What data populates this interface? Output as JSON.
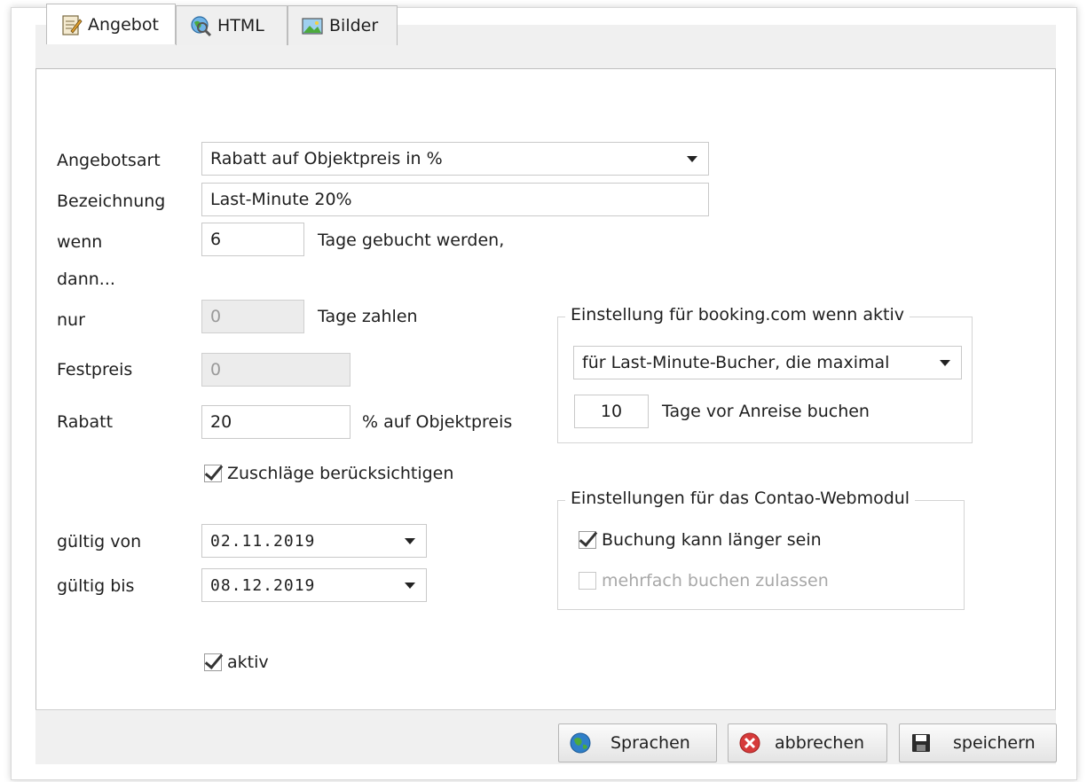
{
  "tabs": [
    {
      "label": "Angebot",
      "icon": "notepad-icon",
      "active": true
    },
    {
      "label": "HTML",
      "icon": "globe-magnifier-icon",
      "active": false
    },
    {
      "label": "Bilder",
      "icon": "picture-icon",
      "active": false
    }
  ],
  "form": {
    "angebotsart_label": "Angebotsart",
    "angebotsart_value": "Rabatt auf Objektpreis in %",
    "bezeichnung_label": "Bezeichnung",
    "bezeichnung_value": "Last-Minute 20%",
    "wenn_label": "wenn",
    "dann_label": "dann...",
    "wenn_value": "6",
    "wenn_suffix": "Tage gebucht werden,",
    "nur_label": "nur",
    "nur_value": "0",
    "nur_suffix": "Tage zahlen",
    "festpreis_label": "Festpreis",
    "festpreis_value": "0",
    "rabatt_label": "Rabatt",
    "rabatt_value": "20",
    "rabatt_suffix": "% auf Objektpreis",
    "zuschlaege_label": "Zuschläge berücksichtigen",
    "zuschlaege_checked": true,
    "gueltig_von_label": "gültig von",
    "gueltig_von_value": "02.11.2019",
    "gueltig_bis_label": "gültig bis",
    "gueltig_bis_value": "08.12.2019",
    "aktiv_label": "aktiv",
    "aktiv_checked": true
  },
  "booking": {
    "legend": "Einstellung für booking.com wenn aktiv",
    "mode_value": "für Last-Minute-Bucher, die maximal",
    "days_value": "10",
    "days_suffix": "Tage vor Anreise buchen"
  },
  "contao": {
    "legend": "Einstellungen für das Contao-Webmodul",
    "longer_label": "Buchung kann länger sein",
    "longer_checked": true,
    "multi_label": "mehrfach buchen zulassen",
    "multi_checked": false
  },
  "buttons": {
    "sprachen": "Sprachen",
    "abbrechen": "abbrechen",
    "speichern": "speichern"
  },
  "colors": {
    "tab_bg": "#efefef",
    "disabled_bg": "#ececec",
    "cancel_red": "#d63a3a",
    "globe_blue": "#2f7fc8",
    "globe_green": "#4caa3c"
  }
}
